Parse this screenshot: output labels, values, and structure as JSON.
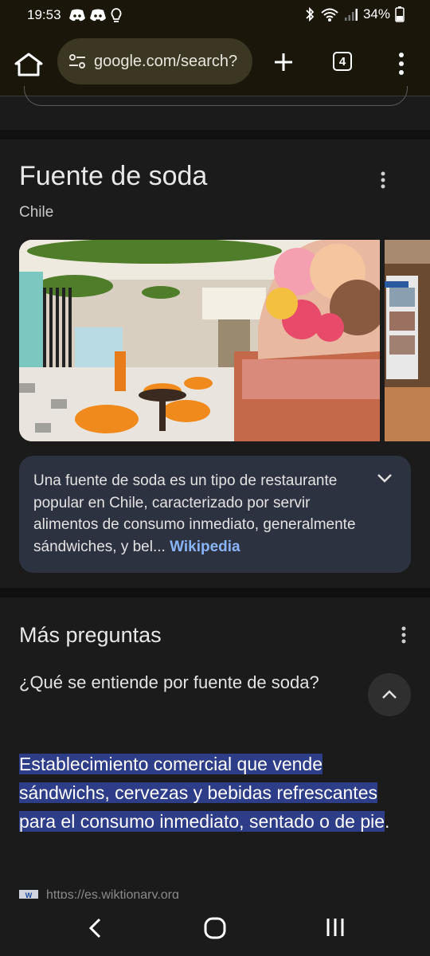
{
  "status_bar": {
    "time": "19:53",
    "battery": "34%",
    "icons": [
      "discord-icon",
      "discord-icon",
      "lightbulb-icon",
      "bluetooth-icon",
      "wifi-icon",
      "signal-icon",
      "battery-icon"
    ]
  },
  "browser": {
    "url": "google.com/search?",
    "tab_count": "4",
    "icons": [
      "home-icon",
      "tune-icon",
      "plus-icon",
      "more-vert-icon"
    ]
  },
  "knowledge_panel": {
    "title": "Fuente de soda",
    "subtitle": "Chile",
    "description": "Una fuente de soda es un tipo de restaurante popular en Chile, caracterizado por servir alimentos de consumo inmediato, generalmente sándwiches, y bel...",
    "source_link": "Wikipedia"
  },
  "more_questions": {
    "heading": "Más preguntas",
    "question": "¿Qué se entiende por fuente de soda?",
    "answer_highlighted": "Establecimiento comercial que vende sándwichs, cervezas y bebidas refrescantes para el consumo inmediato, sentado o de pie",
    "answer_tail": ".",
    "source_url": "https://es.wiktionary.org"
  },
  "colors": {
    "background": "#1b1b1b",
    "toolbar": "#1a1609",
    "link": "#8ab4f8",
    "highlight": "#2e3d88",
    "card": "#2d3240"
  }
}
